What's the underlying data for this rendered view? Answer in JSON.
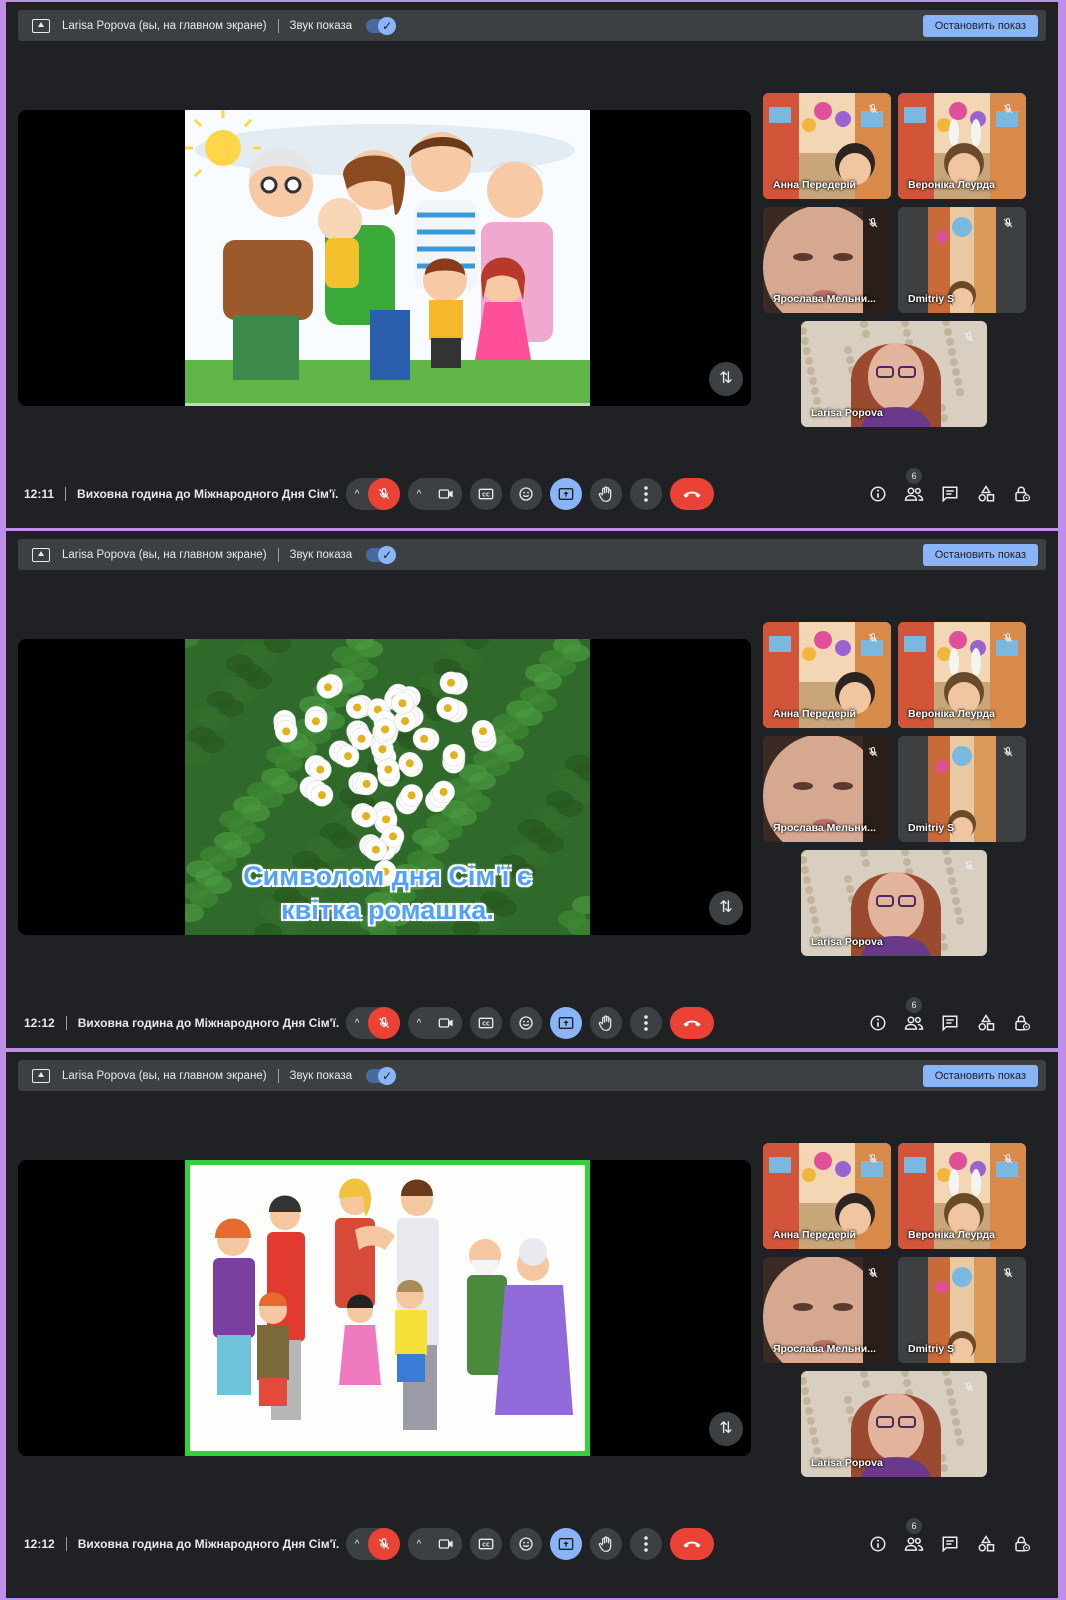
{
  "panels": [
    {
      "presenting_text": "Larisa Popova (вы, на главном экране)",
      "audio_label": "Звук показа",
      "stop_button": "Остановить показ",
      "clock": "12:11",
      "meeting_title": "Виховна година до Міжнародного Дня Сім'ї.",
      "participants_count": "6",
      "slide": "cartoon-family-sunny"
    },
    {
      "presenting_text": "Larisa Popova (вы, на главном экране)",
      "audio_label": "Звук показа",
      "stop_button": "Остановить показ",
      "clock": "12:12",
      "meeting_title": "Виховна година до Міжнародного Дня Сім'ї.",
      "participants_count": "6",
      "slide": "daisy-heart",
      "slide_caption_line1": "Символом дня Сім'ї є",
      "slide_caption_line2": "квітка ромашка."
    },
    {
      "presenting_text": "Larisa Popova (вы, на главном экране)",
      "audio_label": "Звук показа",
      "stop_button": "Остановить показ",
      "clock": "12:12",
      "meeting_title": "Виховна година до Міжнародного Дня Сім'ї.",
      "participants_count": "6",
      "slide": "drawn-family"
    }
  ],
  "participants": [
    {
      "name": "Анна Передерій",
      "bg": "street"
    },
    {
      "name": "Вероніка Леурда",
      "bg": "street"
    },
    {
      "name": "Ярослава Мельни...",
      "bg": "face"
    },
    {
      "name": "Dmitriy S",
      "bg": "street-narrow"
    },
    {
      "name": "Larisa Popova",
      "bg": "teacher"
    }
  ],
  "colors": {
    "accent": "#8ab4f8",
    "danger": "#ea4335",
    "panel_bg": "#202124",
    "surface": "#3c4043",
    "frame": "#c08ee8"
  },
  "icons": [
    "present-icon",
    "check-icon",
    "swap-icon",
    "mic-off-icon",
    "camera-icon",
    "captions-icon",
    "emoji-icon",
    "present-now-icon",
    "raise-hand-icon",
    "more-icon",
    "hangup-icon",
    "info-icon",
    "people-icon",
    "chat-icon",
    "activities-icon",
    "host-controls-icon"
  ]
}
